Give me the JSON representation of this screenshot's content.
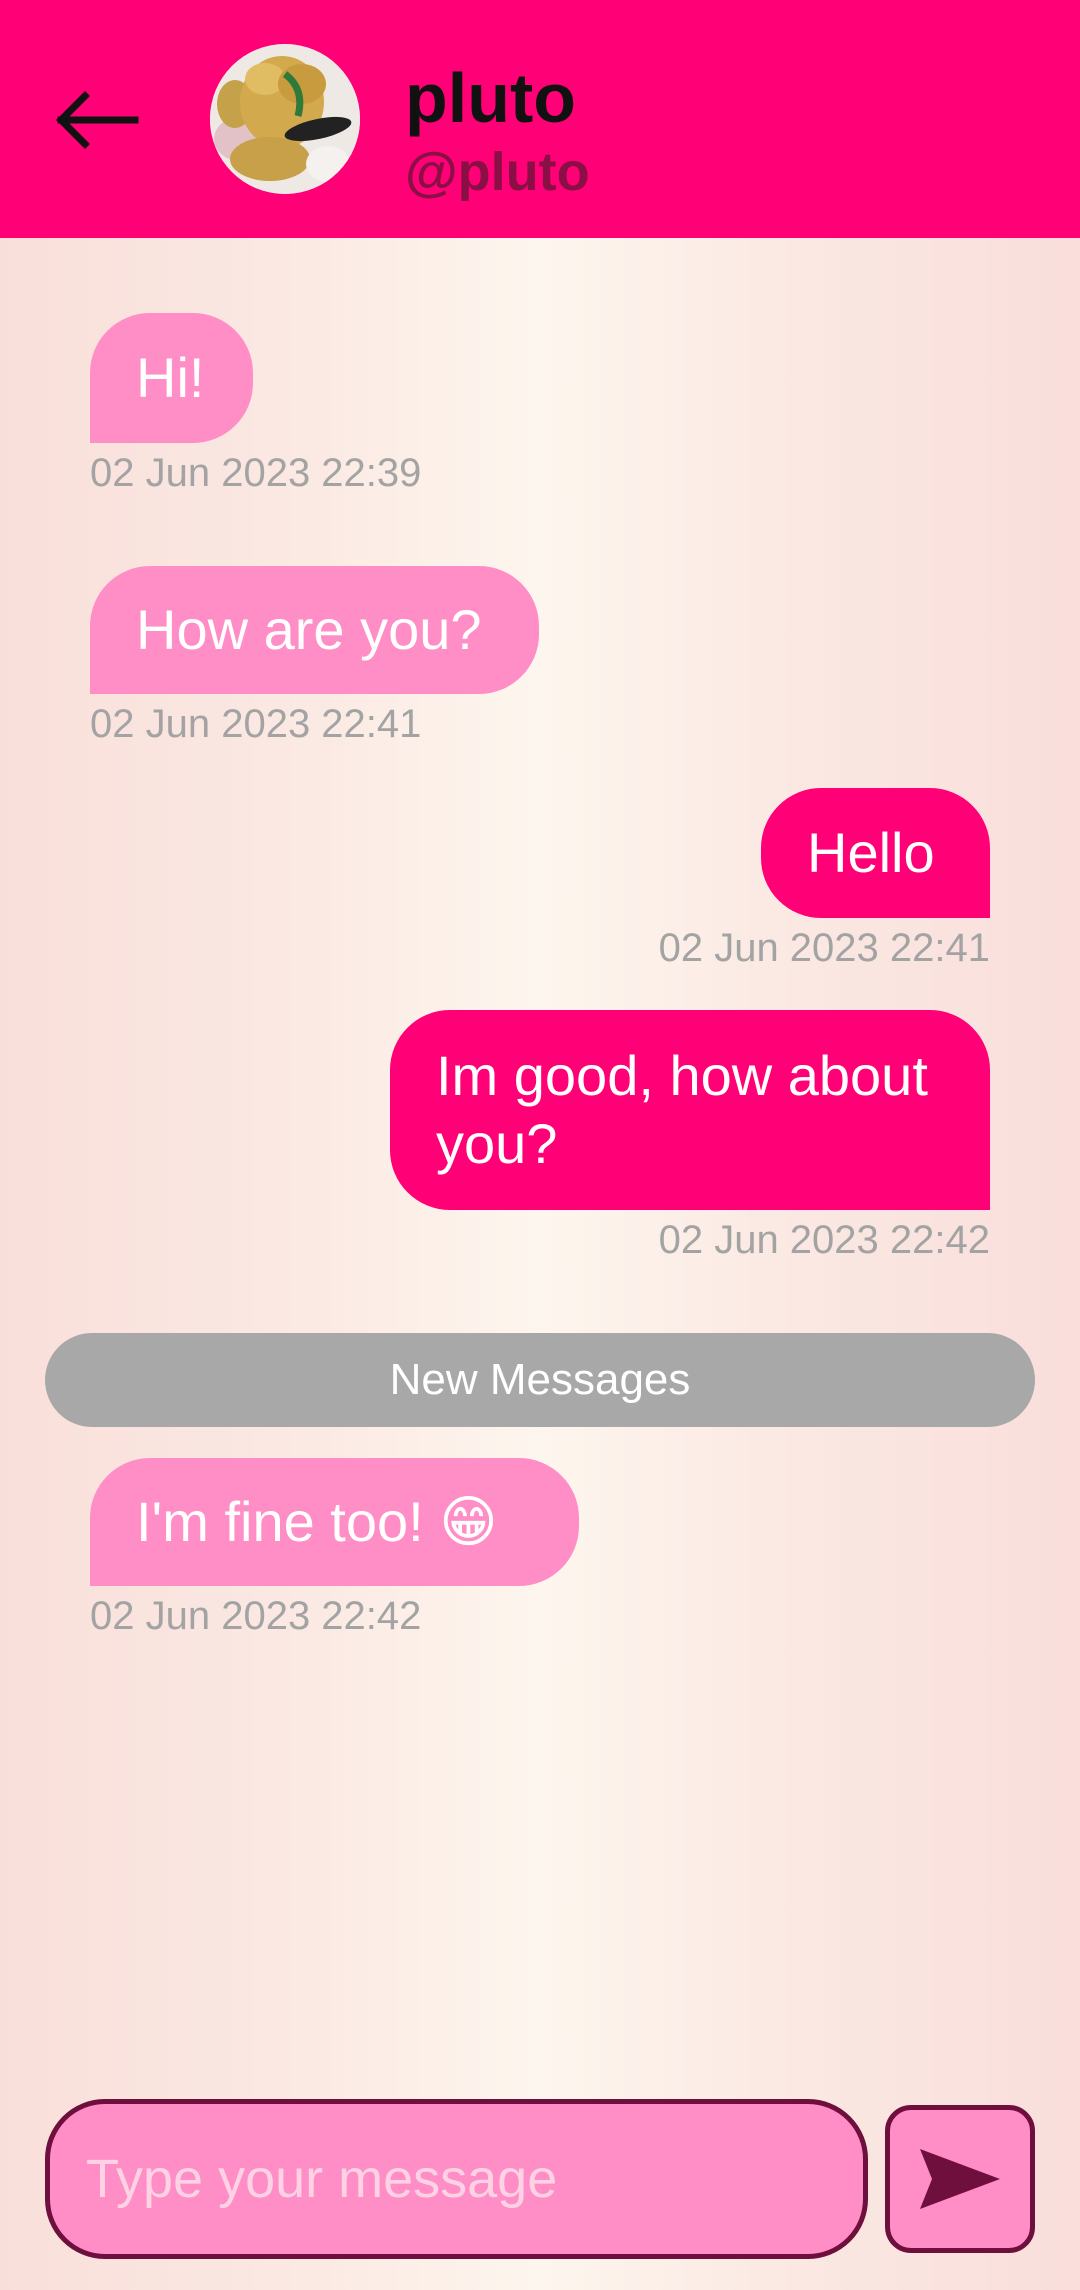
{
  "header": {
    "name": "pluto",
    "handle": "@pluto"
  },
  "messages": [
    {
      "direction": "incoming",
      "text": "Hi!",
      "time": "02 Jun 2023 22:39"
    },
    {
      "direction": "incoming",
      "text": "How are you?",
      "time": "02 Jun 2023 22:41"
    },
    {
      "direction": "outgoing",
      "text": "Hello",
      "time": "02 Jun 2023 22:41"
    },
    {
      "direction": "outgoing",
      "text": "Im good, how about you?",
      "time": "02 Jun 2023 22:42"
    },
    {
      "direction": "incoming",
      "text": "I'm fine too! 😁",
      "time": "02 Jun 2023 22:42"
    }
  ],
  "divider": {
    "label": "New Messages"
  },
  "composer": {
    "placeholder": "Type your message",
    "value": ""
  },
  "colors": {
    "header": "#ff0077",
    "incoming_bubble": "#ff8dc6",
    "outgoing_bubble": "#ff0077",
    "timestamp": "#a3a3a3",
    "divider": "#a8a8a8"
  },
  "icons": {
    "back": "arrow-left-icon",
    "send": "send-icon"
  }
}
